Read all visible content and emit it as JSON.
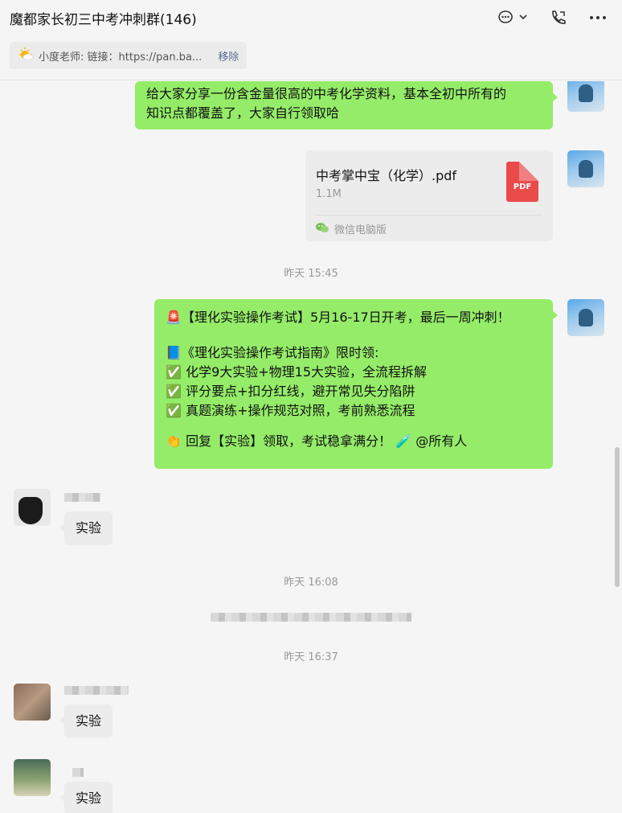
{
  "header": {
    "title": "魔都家长初三中考冲刺群(146)",
    "pinned_text": "小度老师: 链接：https://pan.ba...",
    "pinned_remove": "移除"
  },
  "messages": {
    "msg1_line1": "给大家分享一份含金量很高的中考化学资料，基本全初中所有的",
    "msg1_line2": "知识点都覆盖了，大家自行领取哈",
    "file_name": "中考掌中宝（化学）.pdf",
    "file_size": "1.1M",
    "file_type": "PDF",
    "file_source": "微信电脑版",
    "time1": "昨天 15:45",
    "announce_l1": "【理化实验操作考试】5月16-17日开考，最后一周冲刺！",
    "announce_l2": "《理化实验操作考试指南》限时领:",
    "announce_l3": "化学9大实验+物理15大实验，全流程拆解",
    "announce_l4": "评分要点+扣分红线，避开常见失分陷阱",
    "announce_l5": "真题演练+操作规范对照，考前熟悉流程",
    "announce_l6": "回复【实验】领取，考试稳拿满分！",
    "announce_mention": "@所有人",
    "reply1": "实验",
    "time2": "昨天 16:08",
    "time3": "昨天 16:37",
    "reply2": "实验",
    "reply3": "实验"
  },
  "icons": [
    "chat-bubble-icon",
    "chevron-down-icon",
    "phone-icon",
    "more-icon",
    "sun-icon",
    "pdf-icon",
    "wechat-icon"
  ],
  "colors": {
    "my_bubble": "#95ec69",
    "other_bubble": "#ececec",
    "link": "#576b95"
  }
}
